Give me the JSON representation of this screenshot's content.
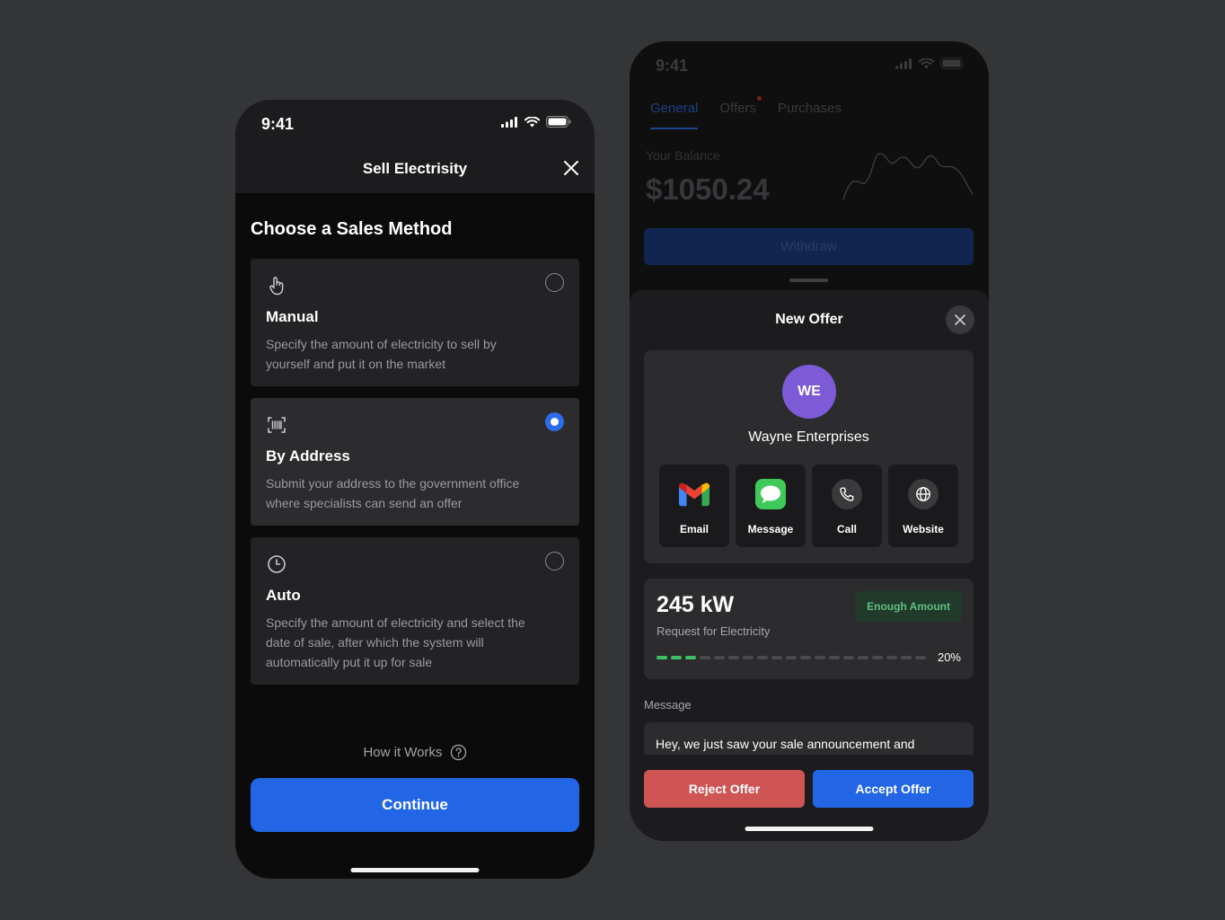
{
  "sell_screen": {
    "status_time": "9:41",
    "title": "Sell Electrisity",
    "section_title": "Choose a Sales Method",
    "methods": [
      {
        "title": "Manual",
        "description": "Specify the amount of electricity to sell by yourself and put it on the market",
        "icon": "hand-pointer-icon",
        "selected": false
      },
      {
        "title": "By Address",
        "description": "Submit your address to the government office where specialists can send an offer",
        "icon": "barcode-scan-icon",
        "selected": true
      },
      {
        "title": "Auto",
        "description": "Specify the amount of electricity and select the date of sale, after which the system will automatically put it up for sale",
        "icon": "clock-icon",
        "selected": false
      }
    ],
    "how_it_works": "How it Works",
    "continue_label": "Continue"
  },
  "offer_screen": {
    "status_time": "9:41",
    "tabs": [
      {
        "label": "General",
        "active": true
      },
      {
        "label": "Offers",
        "active": false,
        "notification": true
      },
      {
        "label": "Purchases",
        "active": false
      }
    ],
    "balance_label": "Your Balance",
    "balance_value": "$1050.24",
    "withdraw_label": "Withdraw",
    "sheet_title": "New Offer",
    "company": {
      "initials": "WE",
      "name": "Wayne Enterprises",
      "avatar_color": "#7d5ad6"
    },
    "actions": [
      {
        "label": "Email",
        "icon": "gmail-icon"
      },
      {
        "label": "Message",
        "icon": "message-bubble-icon"
      },
      {
        "label": "Call",
        "icon": "phone-icon"
      },
      {
        "label": "Website",
        "icon": "globe-icon"
      }
    ],
    "request": {
      "amount": "245 kW",
      "subtitle": "Request for Electricity",
      "badge": "Enough Amount",
      "progress_percent": 20,
      "progress_label": "20%"
    },
    "message_label": "Message",
    "message_text": "Hey, we just saw your sale announcement and",
    "reject_label": "Reject Offer",
    "accept_label": "Accept Offer"
  },
  "colors": {
    "accent": "#2266e6",
    "reject": "#cf5454",
    "success": "#3fbf63",
    "background": "#343537"
  }
}
